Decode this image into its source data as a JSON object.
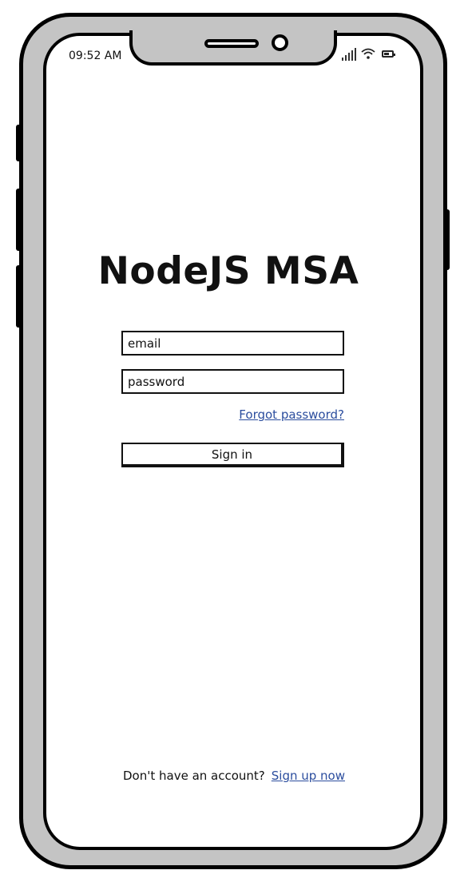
{
  "status_bar": {
    "time": "09:52 AM",
    "signal_icon": "cellular-signal-icon",
    "wifi_icon": "wifi-icon",
    "battery_icon": "battery-icon"
  },
  "app": {
    "title": "NodeJS MSA"
  },
  "login_form": {
    "email_placeholder": "email",
    "password_placeholder": "password",
    "forgot_password_label": "Forgot password?",
    "sign_in_label": "Sign in"
  },
  "footer": {
    "prompt": "Don't have an account?",
    "signup_label": "Sign up now"
  },
  "colors": {
    "link": "#2b4d9e",
    "frame": "#c4c4c4",
    "outline": "#000000"
  }
}
